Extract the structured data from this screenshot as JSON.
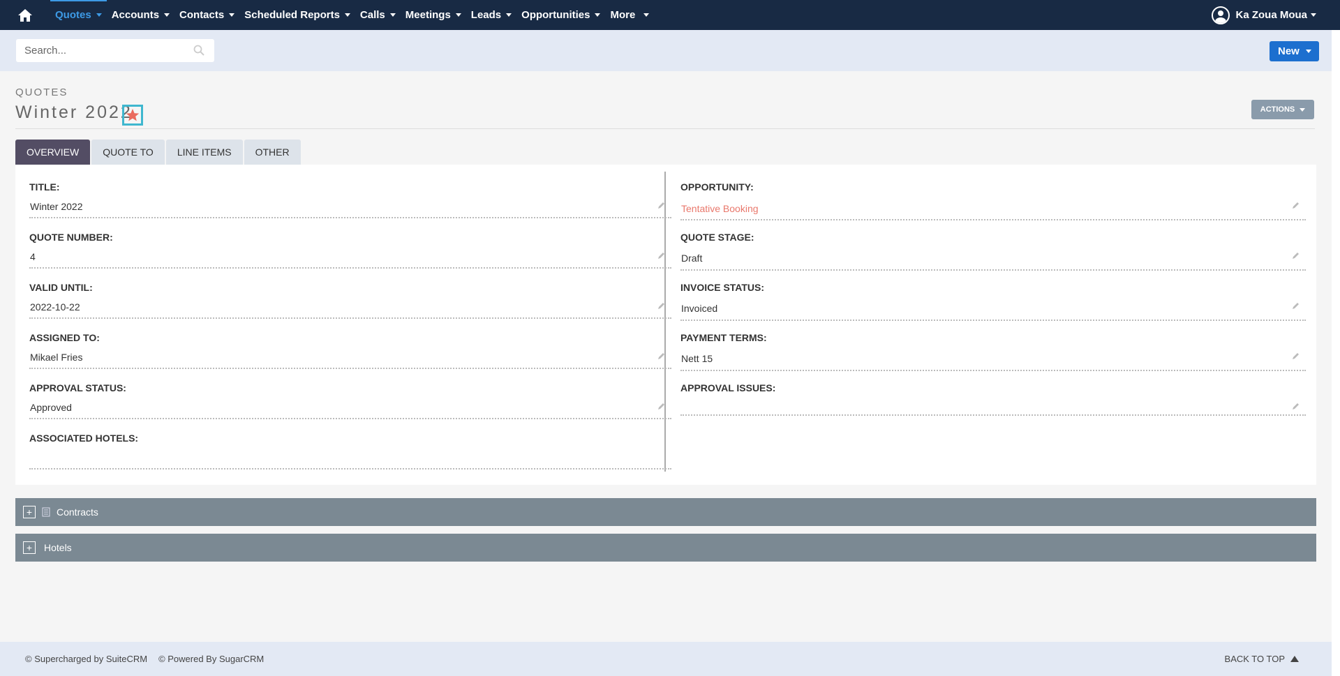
{
  "nav": {
    "items": [
      {
        "label": "Quotes"
      },
      {
        "label": "Accounts"
      },
      {
        "label": "Contacts"
      },
      {
        "label": "Scheduled Reports"
      },
      {
        "label": "Calls"
      },
      {
        "label": "Meetings"
      },
      {
        "label": "Leads"
      },
      {
        "label": "Opportunities"
      },
      {
        "label": "More"
      }
    ],
    "user": "Ka Zoua Moua"
  },
  "search": {
    "placeholder": "Search..."
  },
  "new_button": "New",
  "header": {
    "module": "QUOTES",
    "title": "Winter 2022",
    "actions": "ACTIONS"
  },
  "tabs": [
    {
      "label": "OVERVIEW"
    },
    {
      "label": "QUOTE TO"
    },
    {
      "label": "LINE ITEMS"
    },
    {
      "label": "OTHER"
    }
  ],
  "fields": {
    "title": {
      "label": "TITLE:",
      "value": "Winter 2022"
    },
    "quote_number": {
      "label": "QUOTE NUMBER:",
      "value": "4"
    },
    "valid_until": {
      "label": "VALID UNTIL:",
      "value": "2022-10-22"
    },
    "assigned_to": {
      "label": "ASSIGNED TO:",
      "value": "Mikael Fries"
    },
    "approval_status": {
      "label": "APPROVAL STATUS:",
      "value": "Approved"
    },
    "associated_hotels": {
      "label": "ASSOCIATED HOTELS:",
      "value": ""
    },
    "opportunity": {
      "label": "OPPORTUNITY:",
      "value": "Tentative Booking"
    },
    "quote_stage": {
      "label": "QUOTE STAGE:",
      "value": "Draft"
    },
    "invoice_status": {
      "label": "INVOICE STATUS:",
      "value": "Invoiced"
    },
    "payment_terms": {
      "label": "PAYMENT TERMS:",
      "value": "Nett 15"
    },
    "approval_issues": {
      "label": "APPROVAL ISSUES:",
      "value": ""
    }
  },
  "subpanels": [
    {
      "label": "Contracts"
    },
    {
      "label": "Hotels"
    }
  ],
  "footer": {
    "suitecrm": "© Supercharged by SuiteCRM",
    "sugarcrm": "© Powered By SugarCRM",
    "back_to_top": "BACK TO TOP"
  },
  "colors": {
    "nav_bg": "#182a44",
    "accent": "#3d9ae6",
    "link": "#e9786c",
    "new_button": "#1c6fcf",
    "tab_active": "#534d64",
    "subpanel": "#7b8993"
  }
}
